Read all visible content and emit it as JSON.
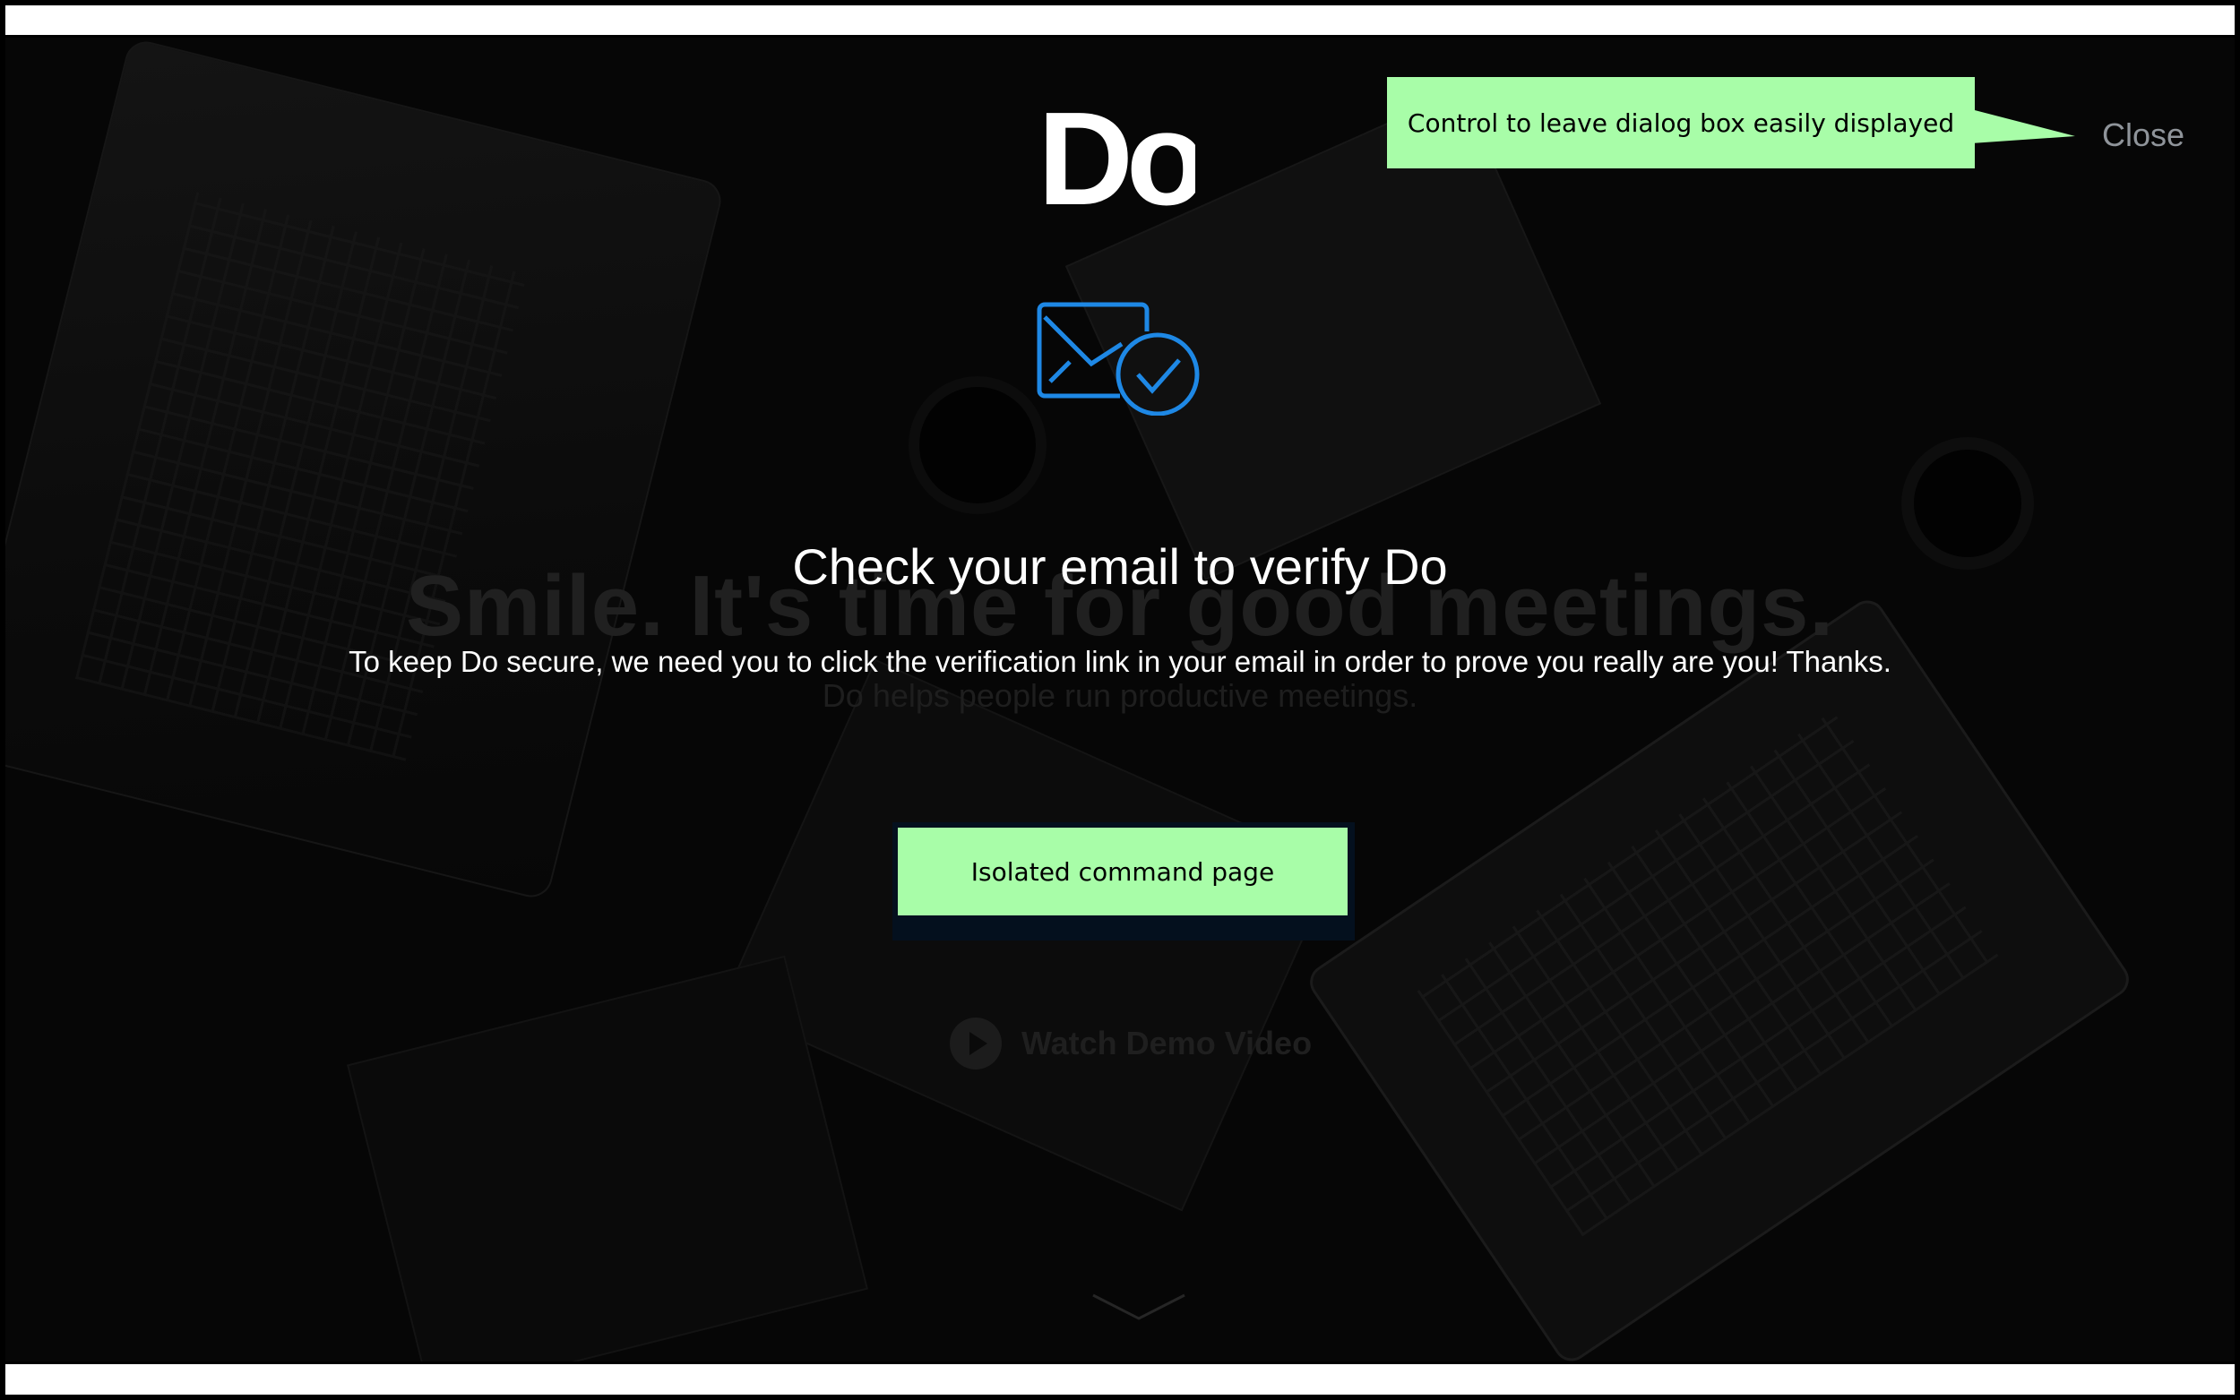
{
  "dialog": {
    "logo_text": "Do",
    "title": "Check your email to verify Do",
    "message": "To keep Do secure, we need you to click the verification link in your email in order to prove you really are you! Thanks.",
    "close_label": "Close"
  },
  "annotations": {
    "close_callout": "Control to leave dialog box easily displayed",
    "button_callout": "Isolated command page"
  },
  "background": {
    "headline": "Smile. It's time for good meetings.",
    "subheadline": "Do helps people run productive meetings.",
    "demo_label": "Watch Demo Video"
  },
  "colors": {
    "accent": "#1e88e5",
    "annotation": "#a8fda8",
    "close": "#8f949a"
  },
  "icons": [
    "do-logo",
    "email-verified-icon",
    "play-icon",
    "chevron-down-icon"
  ]
}
